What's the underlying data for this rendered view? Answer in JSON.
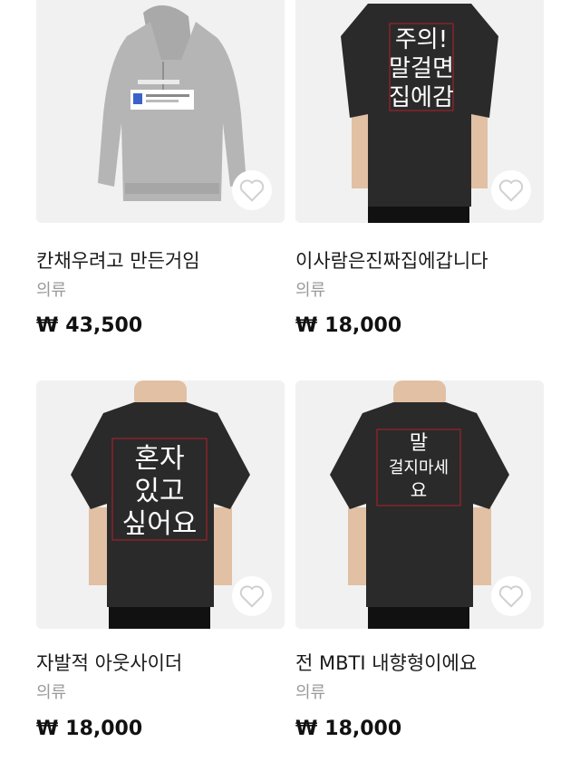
{
  "currency": "₩",
  "products": [
    {
      "title": "칸채우려고 만든거임",
      "category": "의류",
      "price": "43,500",
      "image": "gray-hoodie"
    },
    {
      "title": "이사람은진짜집에갑니다",
      "category": "의류",
      "price": "18,000",
      "image": "black-tshirt",
      "print_lines": [
        "주의!",
        "말걸면",
        "집에감"
      ]
    },
    {
      "title": "자발적 아웃사이더",
      "category": "의류",
      "price": "18,000",
      "image": "black-tshirt",
      "print_lines": [
        "혼자",
        "있고",
        "싶어요"
      ]
    },
    {
      "title": "전 MBTI 내향형이에요",
      "category": "의류",
      "price": "18,000",
      "image": "black-tshirt",
      "print_lines": [
        "말",
        "걸지마세",
        "요"
      ]
    }
  ],
  "icons": {
    "favorite": "heart-outline-icon"
  }
}
